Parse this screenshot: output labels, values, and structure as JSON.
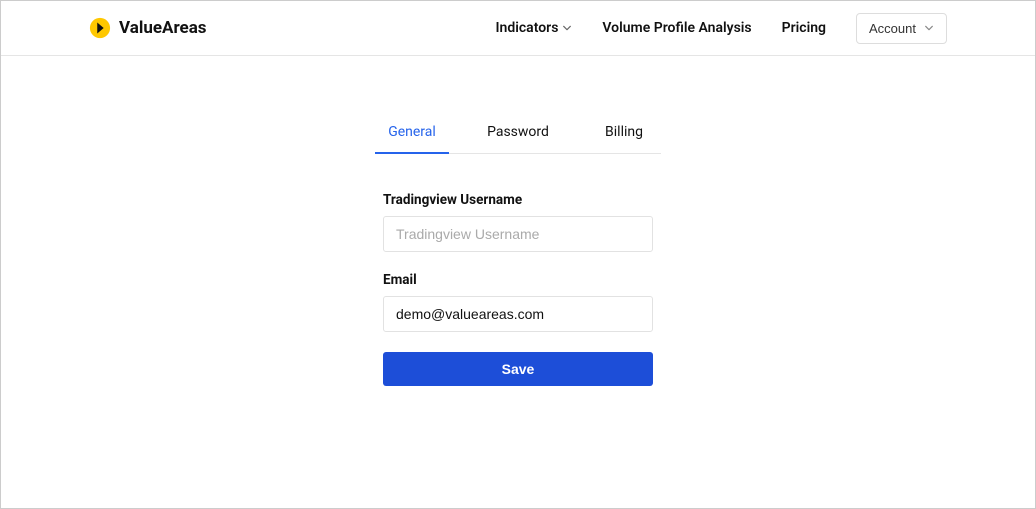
{
  "header": {
    "brand": "ValueAreas",
    "nav": {
      "indicators": "Indicators",
      "volume_profile": "Volume Profile Analysis",
      "pricing": "Pricing"
    },
    "account_label": "Account"
  },
  "tabs": {
    "general": "General",
    "password": "Password",
    "billing": "Billing"
  },
  "form": {
    "username_label": "Tradingview Username",
    "username_placeholder": "Tradingview Username",
    "username_value": "",
    "email_label": "Email",
    "email_value": "demo@valueareas.com",
    "save_label": "Save"
  }
}
